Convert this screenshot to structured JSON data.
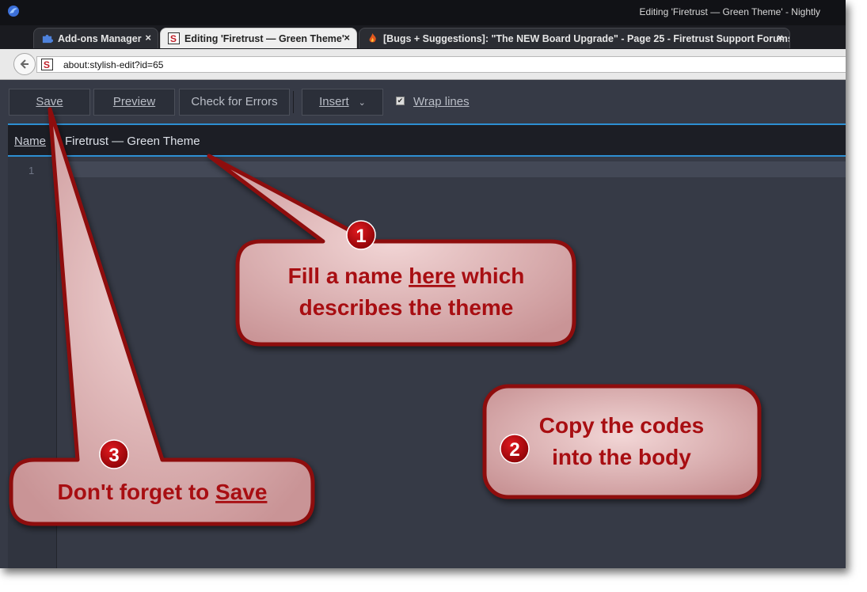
{
  "window": {
    "title": "Editing 'Firetrust — Green Theme' - Nightly"
  },
  "tabs": [
    {
      "label": "Add-ons Manager",
      "icon": "puzzle-icon",
      "active": false
    },
    {
      "label": "Editing 'Firetrust — Green Theme'",
      "icon": "stylish-icon",
      "active": true
    },
    {
      "label": "[Bugs + Suggestions]: \"The NEW Board Upgrade\" - Page 25 - Firetrust Support Forums",
      "icon": "flame-icon",
      "active": false
    }
  ],
  "tab_close": "×",
  "nav": {
    "back_icon": "back-arrow-icon",
    "url": "about:stylish-edit?id=65"
  },
  "toolbar": {
    "save": "Save",
    "preview": "Preview",
    "check": "Check for Errors",
    "insert": "Insert",
    "insert_caret": "⌄",
    "wrap_label": "Wrap lines",
    "wrap_checked": "✔"
  },
  "editor": {
    "name_label": "Name",
    "name_value": "Firetrust — Green Theme",
    "line_number": "1"
  },
  "callouts": [
    {
      "badge": "1",
      "lines": [
        "Fill a name here which",
        "describes the theme"
      ],
      "underline_word": "here"
    },
    {
      "badge": "2",
      "lines": [
        "Copy the codes",
        "into the body"
      ]
    },
    {
      "badge": "3",
      "lines": [
        "Don't forget to Save"
      ],
      "underline_word": "Save"
    }
  ],
  "colors": {
    "callout_text": "#a80e12",
    "callout_border": "#8e0c10",
    "callout_fill": "#d9a6a6",
    "badge_fill": "#b7080d",
    "accent_blue": "#2d8fd2",
    "editor_bg": "#363a46"
  }
}
